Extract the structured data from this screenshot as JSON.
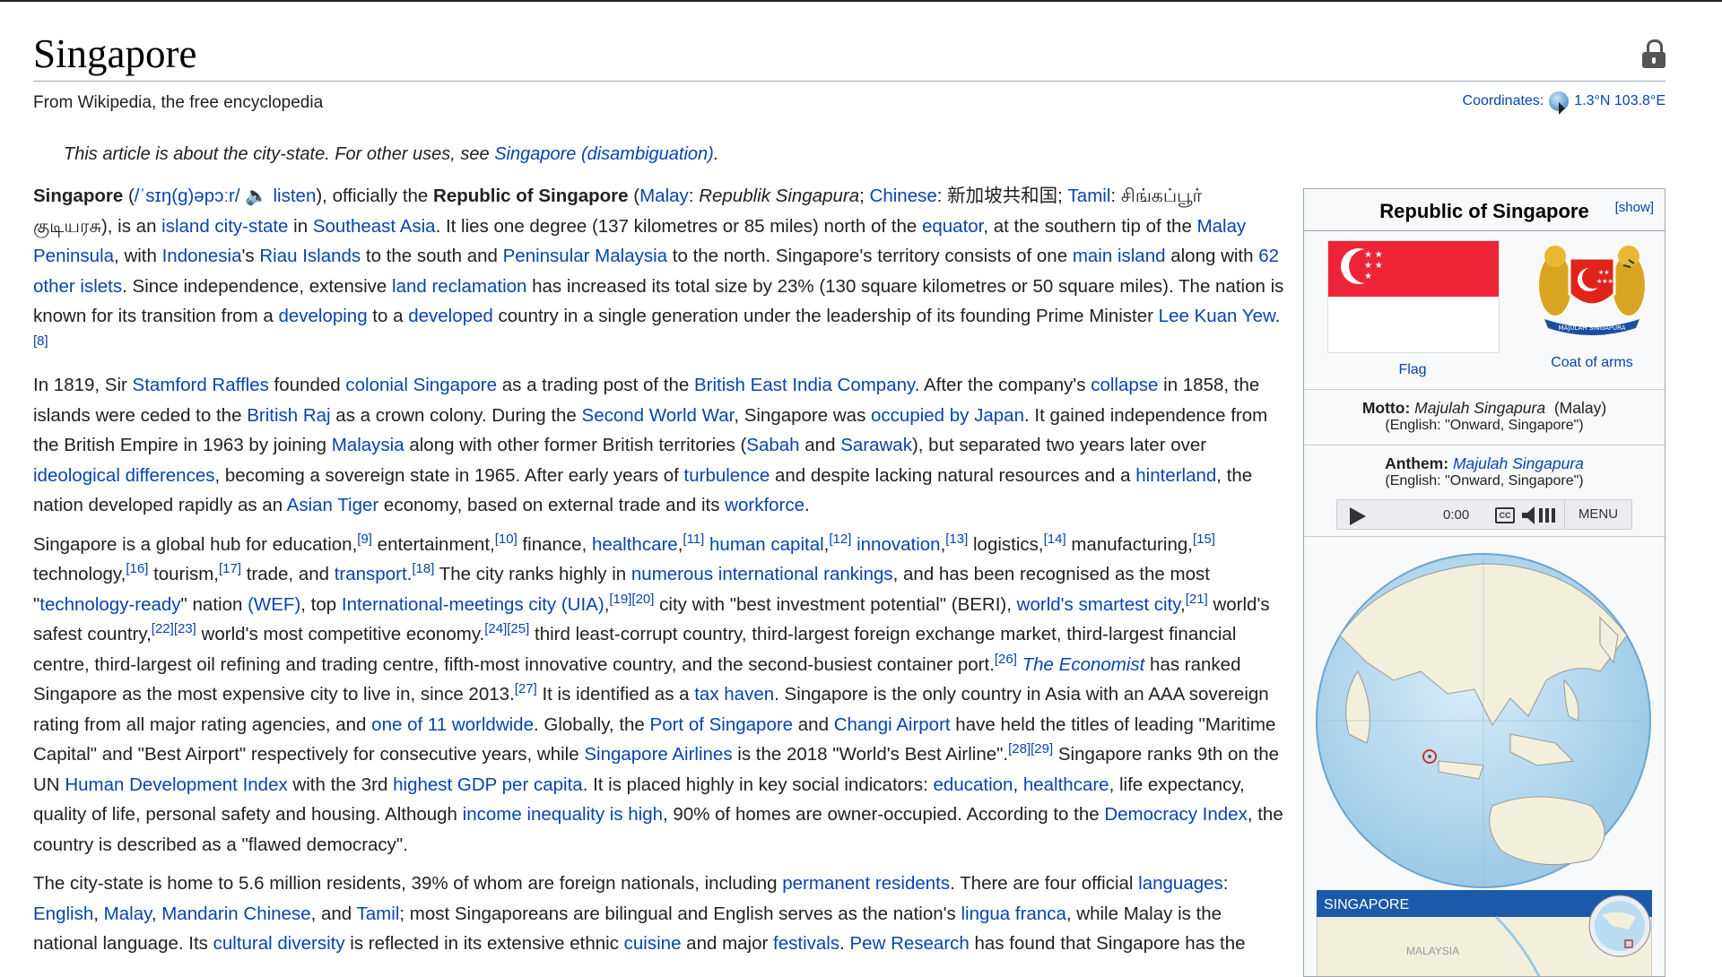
{
  "page": {
    "title": "Singapore",
    "subtitle": "From Wikipedia, the free encyclopedia",
    "coords_label": "Coordinates:",
    "coords_value": "1.3°N 103.8°E",
    "hatnote_prefix": "This article is about the city-state. For other uses, see ",
    "hatnote_link": "Singapore (disambiguation)",
    "hatnote_suffix": "."
  },
  "paragraphs": [
    "<b>Singapore</b> (<span class=\"lnk\">/ˈsɪŋ(ɡ)əpɔːr/</span> <span class=\"lnk\">🔈 listen</span>), officially the <b>Republic of Singapore</b> (<span class=\"lnk\">Malay</span>: <i>Republik Singapura</i>; <span class=\"lnk\">Chinese</span>: 新加坡共和国; <span class=\"lnk\">Tamil</span>: சிங்கப்பூர் குடியரசு), is an <span class=\"lnk\">island city-state</span> in <span class=\"lnk\">Southeast Asia</span>. It lies one degree (137 kilometres or 85 miles) north of the <span class=\"lnk\">equator</span>, at the southern tip of the <span class=\"lnk\">Malay Peninsula</span>, with <span class=\"lnk\">Indonesia</span>'s <span class=\"lnk\">Riau Islands</span> to the south and <span class=\"lnk\">Peninsular Malaysia</span> to the north. Singapore's territory consists of one <span class=\"lnk\">main island</span> along with <span class=\"lnk\">62 other islets</span>. Since independence, extensive <span class=\"lnk\">land reclamation</span> has increased its total size by 23% (130 square kilometres or 50 square miles). The nation is known for its transition from a <span class=\"lnk\">developing</span> to a <span class=\"lnk\">developed</span> country in a single generation under the leadership of its founding Prime Minister <span class=\"lnk\">Lee Kuan Yew</span>.<sup class=\"lnk\">[8]</sup>",
    "In 1819, Sir <span class=\"lnk\">Stamford Raffles</span> founded <span class=\"lnk\">colonial Singapore</span> as a trading post of the <span class=\"lnk\">British East India Company</span>. After the company's <span class=\"lnk\">collapse</span> in 1858, the islands were ceded to the <span class=\"lnk\">British Raj</span> as a crown colony. During the <span class=\"lnk\">Second World War</span>, Singapore was <span class=\"lnk\">occupied by Japan</span>. It gained independence from the British Empire in 1963 by joining <span class=\"lnk\">Malaysia</span> along with other former British territories (<span class=\"lnk\">Sabah</span> and <span class=\"lnk\">Sarawak</span>), but separated two years later over <span class=\"lnk\">ideological differences</span>, becoming a sovereign state in 1965. After early years of <span class=\"lnk\">turbulence</span> and despite lacking natural resources and a <span class=\"lnk\">hinterland</span>, the nation developed rapidly as an <span class=\"lnk\">Asian Tiger</span> economy, based on external trade and its <span class=\"lnk\">workforce</span>.",
    "Singapore is a global hub for education,<sup class=\"lnk\">[9]</sup> entertainment,<sup class=\"lnk\">[10]</sup> finance, <span class=\"lnk\">healthcare</span>,<sup class=\"lnk\">[11]</sup> <span class=\"lnk\">human capital</span>,<sup class=\"lnk\">[12]</sup> <span class=\"lnk\">innovation</span>,<sup class=\"lnk\">[13]</sup> logistics,<sup class=\"lnk\">[14]</sup> manufacturing,<sup class=\"lnk\">[15]</sup> technology,<sup class=\"lnk\">[16]</sup> tourism,<sup class=\"lnk\">[17]</sup> trade, and <span class=\"lnk\">transport</span>.<sup class=\"lnk\">[18]</sup> The city ranks highly in <span class=\"lnk\">numerous international rankings</span>, and has been recognised as the most \"<span class=\"lnk\">technology-ready</span>\" nation <span class=\"lnk\">(WEF)</span>, top <span class=\"lnk\">International-meetings city (UIA)</span>,<sup class=\"lnk\">[19][20]</sup> city with \"best investment potential\" (BERI), <span class=\"lnk\">world's smartest city</span>,<sup class=\"lnk\">[21]</sup> world's safest country,<sup class=\"lnk\">[22][23]</sup> world's most competitive economy.<sup class=\"lnk\">[24][25]</sup> third least-corrupt country, third-largest foreign exchange market, third-largest financial centre, third-largest oil refining and trading centre, fifth-most innovative country, and the second-busiest container port.<sup class=\"lnk\">[26]</sup> <i class=\"lnk\">The Economist</i> has ranked Singapore as the most expensive city to live in, since 2013.<sup class=\"lnk\">[27]</sup> It is identified as a <span class=\"lnk\">tax haven</span>. Singapore is the only country in Asia with an AAA sovereign rating from all major rating agencies, and <span class=\"lnk\">one of 11 worldwide</span>. Globally, the <span class=\"lnk\">Port of Singapore</span> and <span class=\"lnk\">Changi Airport</span> have held the titles of leading \"Maritime Capital\" and \"Best Airport\" respectively for consecutive years, while <span class=\"lnk\">Singapore Airlines</span> is the 2018 \"World's Best Airline\".<sup class=\"lnk\">[28][29]</sup> Singapore ranks 9th on the UN <span class=\"lnk\">Human Development Index</span> with the 3rd <span class=\"lnk\">highest GDP per capita</span>. It is placed highly in key social indicators: <span class=\"lnk\">education</span>, <span class=\"lnk\">healthcare</span>, life expectancy, quality of life, personal safety and housing. Although <span class=\"lnk\">income inequality is high</span>, 90% of homes are owner-occupied. According to the <span class=\"lnk\">Democracy Index</span>, the country is described as a \"flawed democracy\".",
    "The city-state is home to 5.6 million residents, 39% of whom are foreign nationals, including <span class=\"lnk\">permanent residents</span>. There are four official <span class=\"lnk\">languages</span>: <span class=\"lnk\">English</span>, <span class=\"lnk\">Malay</span>, <span class=\"lnk\">Mandarin Chinese</span>, and <span class=\"lnk\">Tamil</span>; most Singaporeans are bilingual and English serves as the nation's <span class=\"lnk\">lingua franca</span>, while Malay is the national language. Its <span class=\"lnk\">cultural diversity</span> is reflected in its extensive ethnic <span class=\"lnk\">cuisine</span> and major <span class=\"lnk\">festivals</span>. <span class=\"lnk\">Pew Research</span> has found that Singapore has the"
  ],
  "infobox": {
    "title": "Republic of Singapore",
    "show_label": "[show]",
    "flag_label": "Flag",
    "coa_label": "Coat of arms",
    "coa_banner": "MAJULAH SINGAPURA",
    "motto_label": "Motto:",
    "motto_value": "Majulah Singapura",
    "motto_lang": "(Malay)",
    "motto_english": "(English: \"Onward, Singapore\")",
    "anthem_label": "Anthem:",
    "anthem_value": "Majulah Singapura",
    "anthem_english": "(English: \"Onward, Singapore\")",
    "player_time": "0:00",
    "player_cc": "CC",
    "player_menu": "MENU",
    "map_title": "SINGAPORE",
    "map_label": "MALAYSIA"
  },
  "colors": {
    "link": "#0645ad",
    "flag_red": "#ee2436",
    "map_header": "#1a5aa8",
    "ocean": "#b9dcf0",
    "land": "#f2f0dc"
  },
  "icons": [
    "lock-icon",
    "globe-icon",
    "speaker-icon",
    "play-icon",
    "cc-icon",
    "volume-icon"
  ]
}
